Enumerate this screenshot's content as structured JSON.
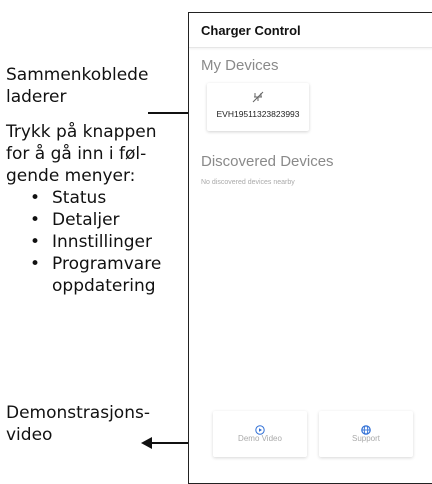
{
  "annotations": {
    "connected": "Sammenkoblede laderer",
    "instructions": "Trykk på knappen for å gå inn i føl-gende menyer:",
    "menu_items": [
      "Status",
      "Detaljer",
      "Innstillinger",
      "Programvare oppdatering"
    ],
    "demo": "Demonstrasjons-video"
  },
  "app": {
    "title": "Charger Control",
    "my_devices_title": "My Devices",
    "device": {
      "icon": "plug-disconnected-icon",
      "id": "EVH19511323823993"
    },
    "discovered_title": "Discovered Devices",
    "discovered_empty": "No discovered devices nearby",
    "buttons": {
      "demo": {
        "label": "Demo Video",
        "icon": "play-circle-icon"
      },
      "support": {
        "label": "Support",
        "icon": "globe-icon"
      }
    }
  },
  "colors": {
    "accent": "#2f6fd6",
    "muted_text": "#8a8a8a"
  }
}
